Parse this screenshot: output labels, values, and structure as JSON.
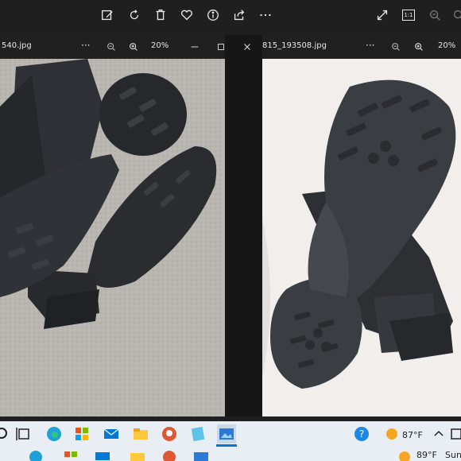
{
  "top_toolbar": {
    "icons": [
      "edit-image-icon",
      "rotate-icon",
      "delete-icon",
      "favorite-icon",
      "info-icon",
      "share-icon",
      "more-icon"
    ],
    "right_icons": [
      "expand-icon",
      "actual-size-icon",
      "zoom-out-icon",
      "zoom-in-icon"
    ],
    "actual_size_label": "1:1"
  },
  "left_window": {
    "file_name": "540.jpg",
    "more_label": "···",
    "zoom": "20%"
  },
  "right_window": {
    "file_name": "815_193508.jpg",
    "more_label": "···",
    "zoom": "20%"
  },
  "taskbar": {
    "apps": [
      "task-view-icon",
      "edge-icon",
      "store-icon",
      "mail-icon",
      "file-explorer-icon",
      "duckduckgo-icon",
      "notepad-icon",
      "photos-icon"
    ],
    "help_icon": "help-icon",
    "temperature": "87°F",
    "row2_temperature": "89°F",
    "row2_day": "Sunn"
  },
  "colors": {
    "window_bg": "#2b2b2b",
    "titlebar_bg": "#202020",
    "taskbar_bg": "#e9eef4",
    "accent": "#0078d4"
  }
}
